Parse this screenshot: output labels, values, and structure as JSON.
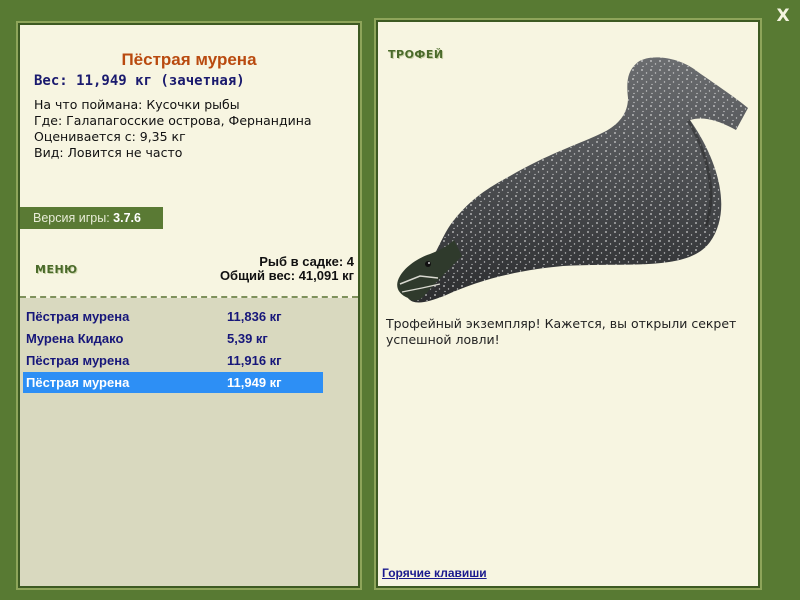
{
  "window": {
    "close_label": "X"
  },
  "fish": {
    "name": "Пёстрая мурена",
    "weight_line": "Вес: 11,949 кг (зачетная)",
    "bait_line": "На что поймана: Кусочки рыбы",
    "location_line": "Где: Галапагосские острова, Фернандина",
    "value_line": "Оценивается с: 9,35 кг",
    "rarity_line": "Вид: Ловится не часто"
  },
  "version": {
    "label": "Версия игры:",
    "value": "3.7.6"
  },
  "menu": {
    "label": "МЕНЮ"
  },
  "summary": {
    "count_line": "Рыб в садке: 4",
    "total_line": "Общий вес: 41,091 кг"
  },
  "catch_list": [
    {
      "name": "Пёстрая мурена",
      "weight": "11,836 кг",
      "selected": false
    },
    {
      "name": "Мурена Кидако",
      "weight": "5,39 кг",
      "selected": false
    },
    {
      "name": "Пёстрая мурена",
      "weight": "11,916 кг",
      "selected": false
    },
    {
      "name": "Пёстрая мурена",
      "weight": "11,949 кг",
      "selected": true
    }
  ],
  "trophy": {
    "label": "ТРОФЕЙ",
    "description": "Трофейный экземпляр! Кажется, вы открыли секрет успешной ловли!"
  },
  "footer": {
    "hotkeys_label": "Горячие клавиши"
  },
  "colors": {
    "frame": "#587a33",
    "panel": "#f7f5e1",
    "selected_row": "#2d8ff5",
    "fish_title": "#b94a0f"
  }
}
